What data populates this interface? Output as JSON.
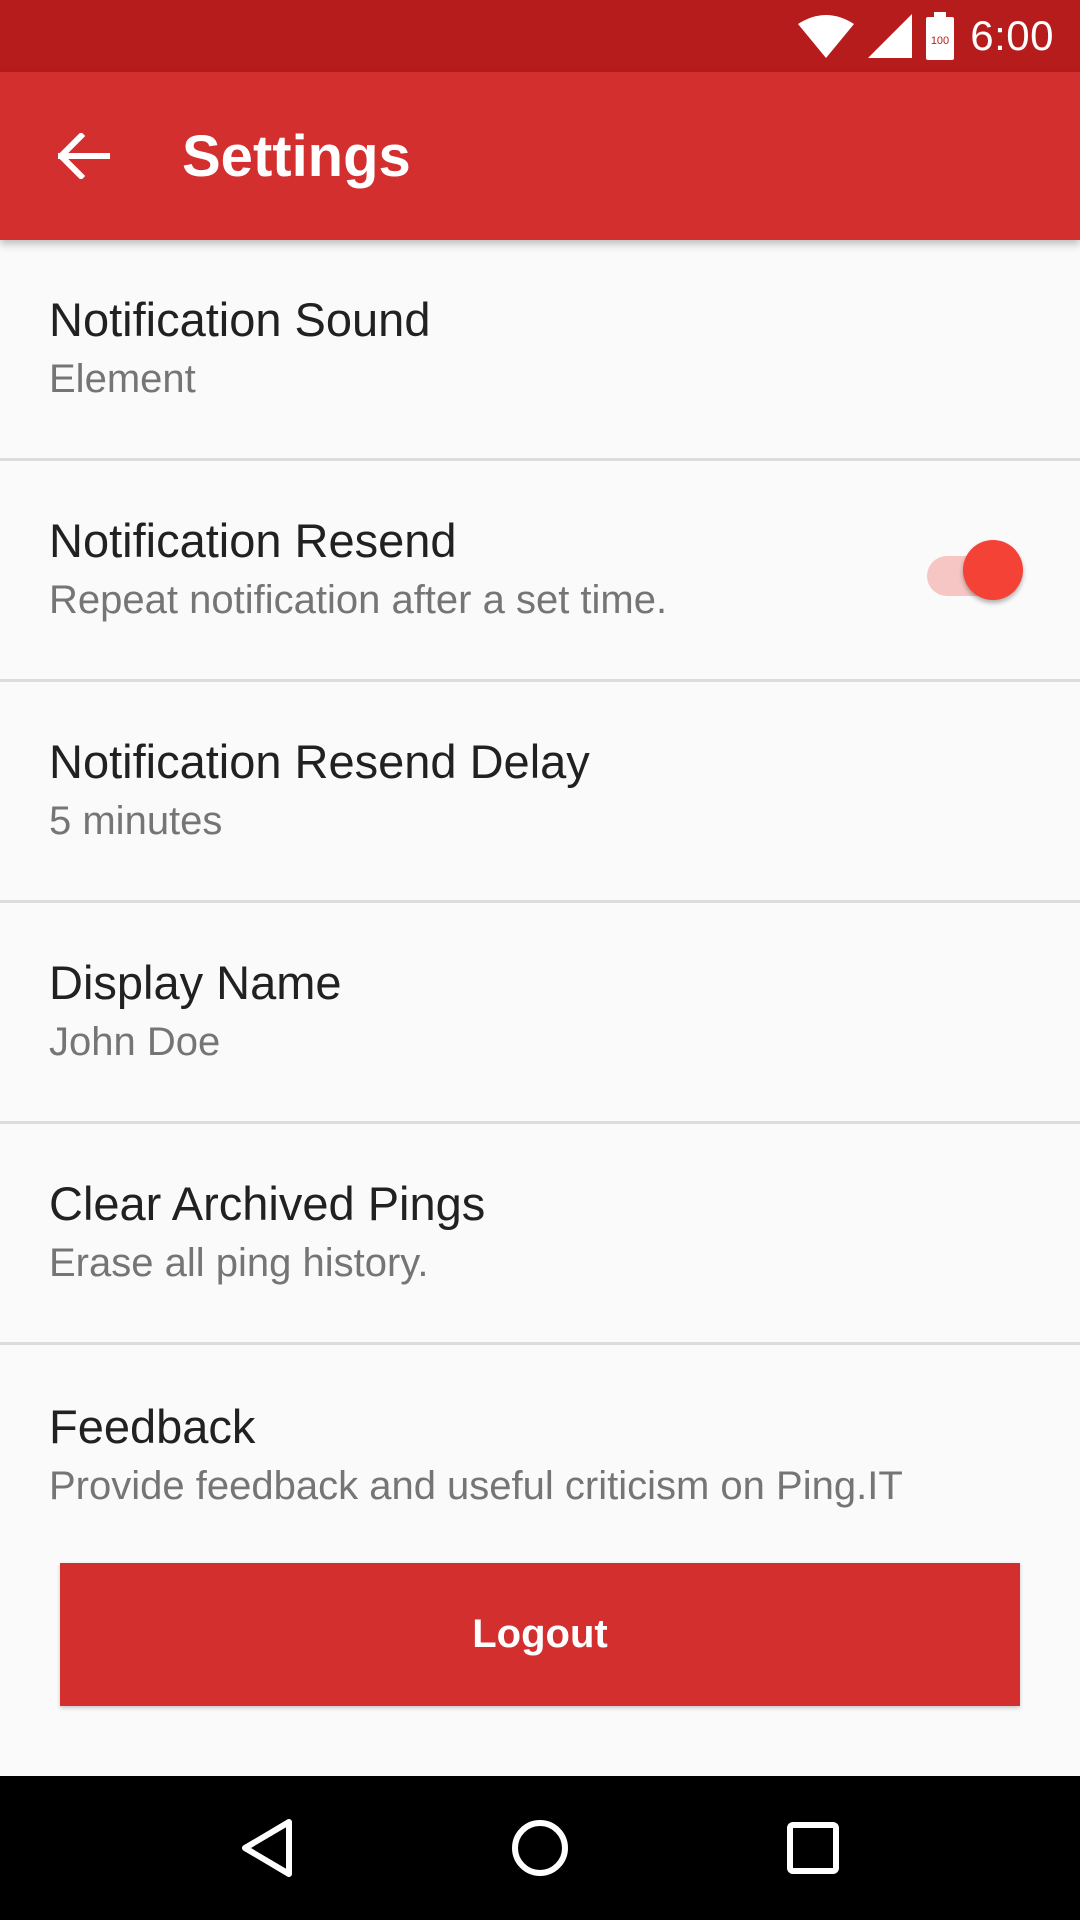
{
  "status_bar": {
    "time": "6:00",
    "battery_level": "100",
    "icons": [
      "wifi-icon",
      "cell-signal-icon",
      "battery-icon"
    ]
  },
  "app_bar": {
    "title": "Settings",
    "back_icon": "arrow-left-icon"
  },
  "settings": [
    {
      "title": "Notification Sound",
      "summary": "Element"
    },
    {
      "title": "Notification Resend",
      "summary": "Repeat notification after a set time.",
      "toggle_on": true
    },
    {
      "title": "Notification Resend Delay",
      "summary": "5 minutes"
    },
    {
      "title": "Display Name",
      "summary": "John Doe"
    },
    {
      "title": "Clear Archived Pings",
      "summary": "Erase all ping history."
    },
    {
      "title": "Feedback",
      "summary": "Provide feedback and useful criticism on Ping.IT"
    }
  ],
  "logout_label": "Logout",
  "nav_bar": {
    "icons": [
      "back-triangle-icon",
      "home-circle-icon",
      "recents-square-icon"
    ]
  },
  "colors": {
    "status_bar": "#b71c1c",
    "primary": "#d32f2f",
    "accent": "#f44336",
    "background": "#fafafa"
  }
}
